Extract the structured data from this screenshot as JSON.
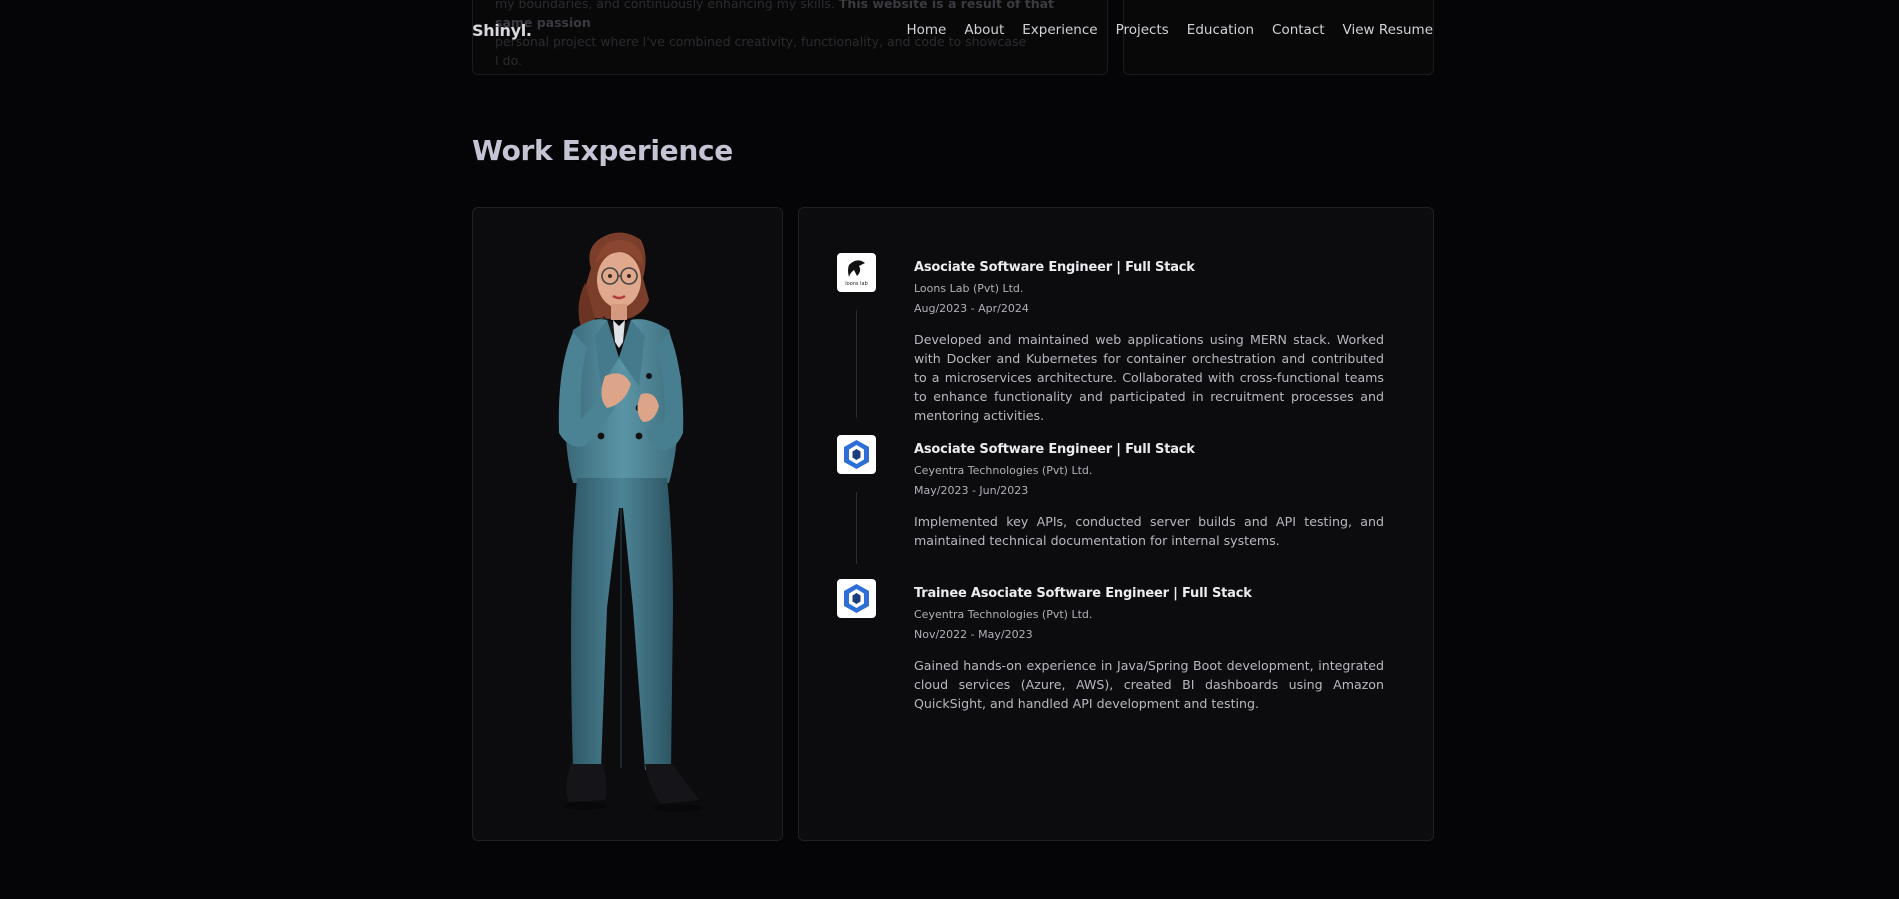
{
  "background": {
    "snippet_line1_a": "my boundaries, and continuously enhancing my skills. ",
    "snippet_line1_b": "This website is a result of that same passion",
    "snippet_line2": "personal project where I've combined creativity, functionality, and code to showcase",
    "snippet_line3": "I do."
  },
  "nav": {
    "brand": "Shinyl.",
    "links": [
      "Home",
      "About",
      "Experience",
      "Projects",
      "Education",
      "Contact",
      "View Resume"
    ]
  },
  "section": {
    "title": "Work Experience"
  },
  "experiences": [
    {
      "title": "Asociate Software Engineer | Full Stack",
      "company": "Loons Lab (Pvt) Ltd.",
      "period": "Aug/2023 - Apr/2024",
      "description": "Developed and maintained web applications using MERN stack. Worked with Docker and Kubernetes for container orchestration and contributed to a microservices architecture. Collaborated with cross-functional teams to enhance functionality and participated in recruitment processes and mentoring activities.",
      "logo": "loons-lab-logo",
      "logo_text": "loons lab"
    },
    {
      "title": "Asociate Software Engineer | Full Stack",
      "company": "Ceyentra Technologies (Pvt) Ltd.",
      "period": "May/2023 - Jun/2023",
      "description": "Implemented key APIs, conducted server builds and API testing, and maintained technical documentation for internal systems.",
      "logo": "ceyentra-logo"
    },
    {
      "title": "Trainee Asociate Software Engineer | Full Stack",
      "company": "Ceyentra Technologies (Pvt) Ltd.",
      "period": "Nov/2022 - May/2023",
      "description": "Gained hands-on experience in Java/Spring Boot development, integrated cloud services (Azure, AWS), created BI dashboards using Amazon QuickSight, and handled API development and testing.",
      "logo": "ceyentra-logo"
    }
  ],
  "colors": {
    "background": "#050507",
    "card": "#0c0c0f",
    "title": "#c4c4d4",
    "suit": "#4f8596"
  }
}
